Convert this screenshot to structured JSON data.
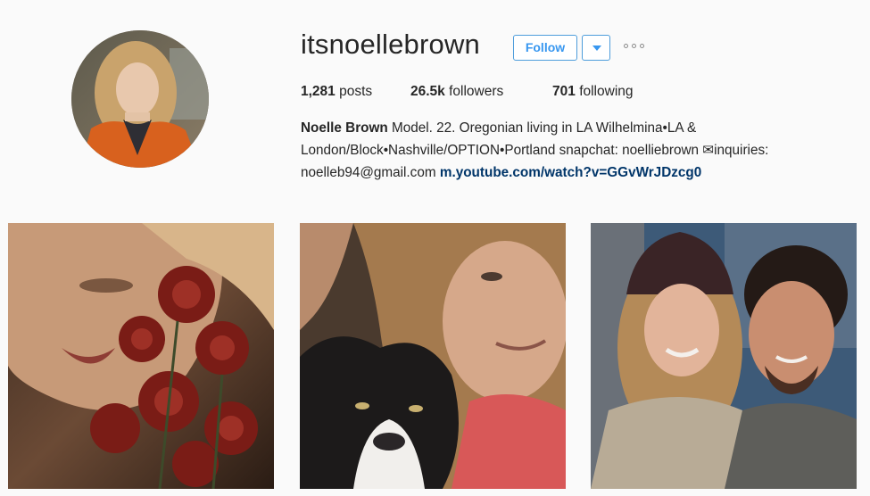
{
  "profile": {
    "username": "itsnoellebrown",
    "follow_label": "Follow"
  },
  "stats": {
    "posts_count": "1,281",
    "posts_label": "posts",
    "followers_count": "26.5k",
    "followers_label": "followers",
    "following_count": "701",
    "following_label": "following"
  },
  "bio": {
    "full_name": "Noelle Brown",
    "line1": " Model. 22. Oregonian living in LA Wilhelmina•LA &",
    "line2": "London/Block•Nashville/OPTION•Portland snapchat: noelliebrown ✉inquiries:",
    "line3": "noelleb94@gmail.com ",
    "link": "m.youtube.com/watch?v=GGvWrJDzcg0"
  },
  "posts": [
    {
      "subject": "woman with red chrysanthemum flowers"
    },
    {
      "subject": "woman lying with black and white cat"
    },
    {
      "subject": "couple selfie, woman in beanie"
    }
  ],
  "colors": {
    "link_blue": "#003569",
    "button_blue": "#3897f0",
    "background": "#fafafa",
    "text": "#262626"
  },
  "icons": {
    "dropdown": "chevron-down-icon",
    "more": "more-options-icon"
  }
}
